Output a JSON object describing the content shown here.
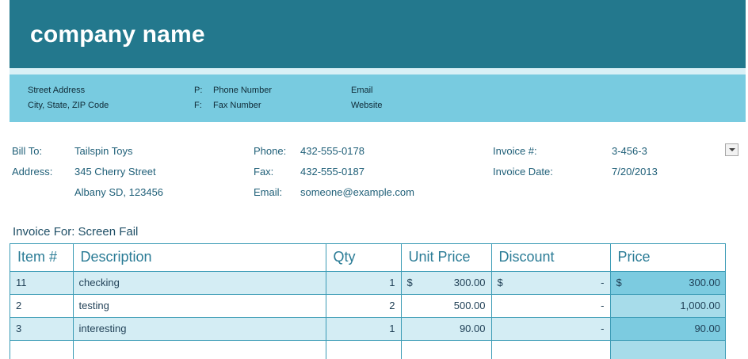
{
  "company": {
    "name": "company name",
    "street": "Street Address",
    "city": "City, State, ZIP Code",
    "phone_label": "P:",
    "phone": "Phone Number",
    "fax_label": "F:",
    "fax": "Fax Number",
    "email": "Email",
    "website": "Website"
  },
  "billing": {
    "bill_to_label": "Bill To:",
    "bill_to": "Tailspin Toys",
    "address_label": "Address:",
    "address_line1": "345 Cherry Street",
    "address_line2": "Albany SD, 123456",
    "phone_label": "Phone:",
    "phone": "432-555-0178",
    "fax_label": "Fax:",
    "fax": "432-555-0187",
    "email_label": "Email:",
    "email": "someone@example.com",
    "invoice_no_label": "Invoice #:",
    "invoice_no": "3-456-3",
    "invoice_date_label": "Invoice Date:",
    "invoice_date": "7/20/2013"
  },
  "invoice_for": "Invoice For: Screen Fail",
  "table": {
    "headers": [
      "Item #",
      "Description",
      "Qty",
      "Unit Price",
      "Discount",
      "Price"
    ],
    "rows": [
      {
        "item": "11",
        "description": "checking",
        "qty": "1",
        "unit_currency": "$",
        "unit_price": "300.00",
        "discount_currency": "$",
        "discount": "-",
        "price_currency": "$",
        "price": "300.00"
      },
      {
        "item": "2",
        "description": "testing",
        "qty": "2",
        "unit_currency": "",
        "unit_price": "500.00",
        "discount_currency": "",
        "discount": "-",
        "price_currency": "",
        "price": "1,000.00"
      },
      {
        "item": "3",
        "description": "interesting",
        "qty": "1",
        "unit_currency": "",
        "unit_price": "90.00",
        "discount_currency": "",
        "discount": "-",
        "price_currency": "",
        "price": "90.00"
      }
    ]
  },
  "colors": {
    "header_band": "#23788d",
    "contact_band": "#78cbe0",
    "table_border": "#3a9bb5",
    "row_tint": "#d4edf4",
    "price_dark": "#7ccbe0",
    "price_light": "#a7dcea"
  },
  "icons": {
    "dropdown": "chevron-down-icon"
  }
}
